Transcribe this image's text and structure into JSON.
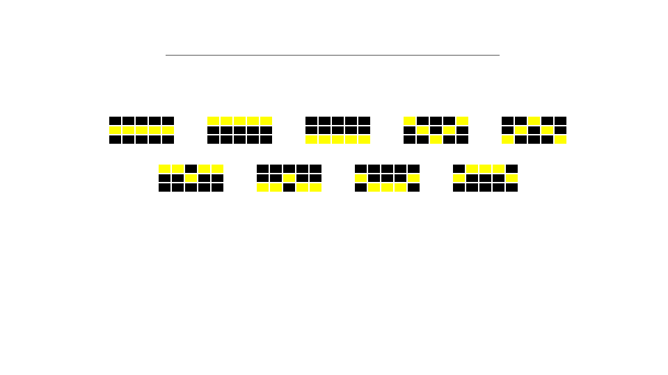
{
  "palette": {
    "on": "#ffff00",
    "off": "#000000",
    "rule": "#595959"
  },
  "patterns": [
    {
      "rows": [
        [
          0,
          0,
          0,
          0,
          0
        ],
        [
          1,
          1,
          1,
          1,
          1
        ],
        [
          0,
          0,
          0,
          0,
          0
        ]
      ]
    },
    {
      "rows": [
        [
          1,
          1,
          1,
          1,
          1
        ],
        [
          0,
          0,
          0,
          0,
          0
        ],
        [
          0,
          0,
          0,
          0,
          0
        ]
      ]
    },
    {
      "rows": [
        [
          0,
          0,
          0,
          0,
          0
        ],
        [
          0,
          0,
          0,
          0,
          0
        ],
        [
          1,
          1,
          1,
          1,
          1
        ]
      ]
    },
    {
      "rows": [
        [
          1,
          0,
          0,
          0,
          1
        ],
        [
          0,
          1,
          0,
          1,
          0
        ],
        [
          0,
          0,
          1,
          0,
          0
        ]
      ]
    },
    {
      "rows": [
        [
          0,
          0,
          1,
          0,
          0
        ],
        [
          0,
          1,
          0,
          1,
          0
        ],
        [
          1,
          0,
          0,
          0,
          1
        ]
      ]
    },
    {
      "rows": [
        [
          1,
          1,
          0,
          1,
          1
        ],
        [
          0,
          0,
          1,
          0,
          0
        ],
        [
          0,
          0,
          0,
          0,
          0
        ]
      ]
    },
    {
      "rows": [
        [
          0,
          0,
          0,
          0,
          0
        ],
        [
          0,
          0,
          1,
          0,
          0
        ],
        [
          1,
          1,
          0,
          1,
          1
        ]
      ]
    },
    {
      "rows": [
        [
          0,
          0,
          0,
          0,
          0
        ],
        [
          1,
          0,
          0,
          0,
          1
        ],
        [
          0,
          1,
          1,
          1,
          0
        ]
      ]
    },
    {
      "rows": [
        [
          0,
          1,
          1,
          1,
          0
        ],
        [
          1,
          0,
          0,
          0,
          1
        ],
        [
          0,
          0,
          0,
          0,
          0
        ]
      ]
    }
  ]
}
